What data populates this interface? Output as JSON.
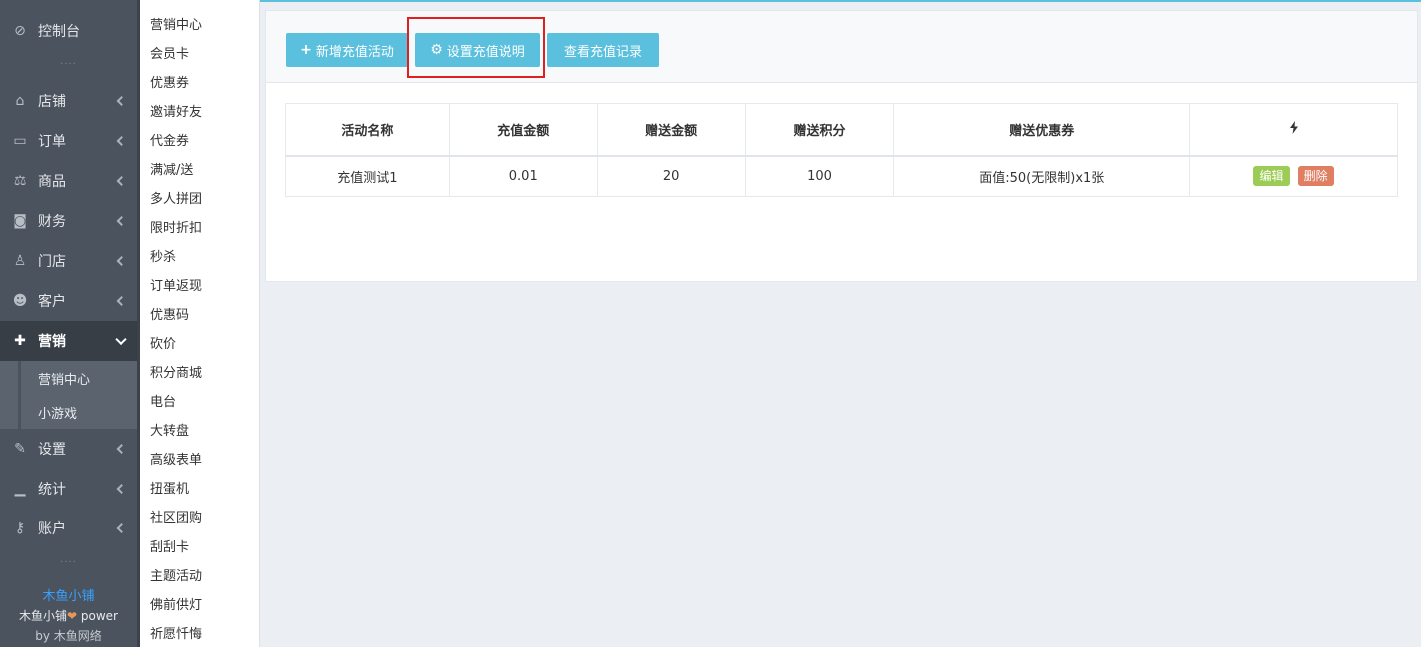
{
  "sidebar": {
    "items": [
      {
        "label": "控制台",
        "icon": "dashboard-icon",
        "glyph": "⊘"
      },
      {
        "label": "店铺",
        "icon": "basket-icon",
        "glyph": "⌂"
      },
      {
        "label": "订单",
        "icon": "money-icon",
        "glyph": "▭"
      },
      {
        "label": "商品",
        "icon": "scale-icon",
        "glyph": "⚖"
      },
      {
        "label": "财务",
        "icon": "cash-icon",
        "glyph": "◙"
      },
      {
        "label": "门店",
        "icon": "sitemap-icon",
        "glyph": "♙"
      },
      {
        "label": "客户",
        "icon": "users-icon",
        "glyph": "☻"
      },
      {
        "label": "营销",
        "icon": "gift-icon",
        "glyph": "✚"
      },
      {
        "label": "设置",
        "icon": "wrench-icon",
        "glyph": "✎"
      },
      {
        "label": "统计",
        "icon": "signal-icon",
        "glyph": "▁"
      },
      {
        "label": "账户",
        "icon": "key-icon",
        "glyph": "⚷"
      }
    ],
    "dots": "····",
    "sub_items": [
      "营销中心",
      "小游戏"
    ],
    "brand_name": "木鱼小铺",
    "brand_power_prefix": "木鱼小铺",
    "brand_heart": "❤",
    "brand_power_suffix": " power",
    "brand_by": "by 木鱼网络"
  },
  "subnav": {
    "items": [
      "营销中心",
      "会员卡",
      "优惠券",
      "邀请好友",
      "代金券",
      "满减/送",
      "多人拼团",
      "限时折扣",
      "秒杀",
      "订单返现",
      "优惠码",
      "砍价",
      "积分商城",
      "电台",
      "大转盘",
      "高级表单",
      "扭蛋机",
      "社区团购",
      "刮刮卡",
      "主题活动",
      "佛前供灯",
      "祈愿忏悔"
    ]
  },
  "toolbar": {
    "add_label": "新增充值活动",
    "settings_label": "设置充值说明",
    "records_label": "查看充值记录",
    "accent": "#5bc0de",
    "highlight_color": "#e0201f"
  },
  "table": {
    "headers": [
      "活动名称",
      "充值金额",
      "赠送金额",
      "赠送积分",
      "赠送优惠券"
    ],
    "action_header_icon": "bolt-icon",
    "rows": [
      {
        "cells": [
          "充值测试1",
          "0.01",
          "20",
          "100",
          "面值:50(无限制)x1张"
        ],
        "edit": "编辑",
        "delete": "删除"
      }
    ]
  }
}
